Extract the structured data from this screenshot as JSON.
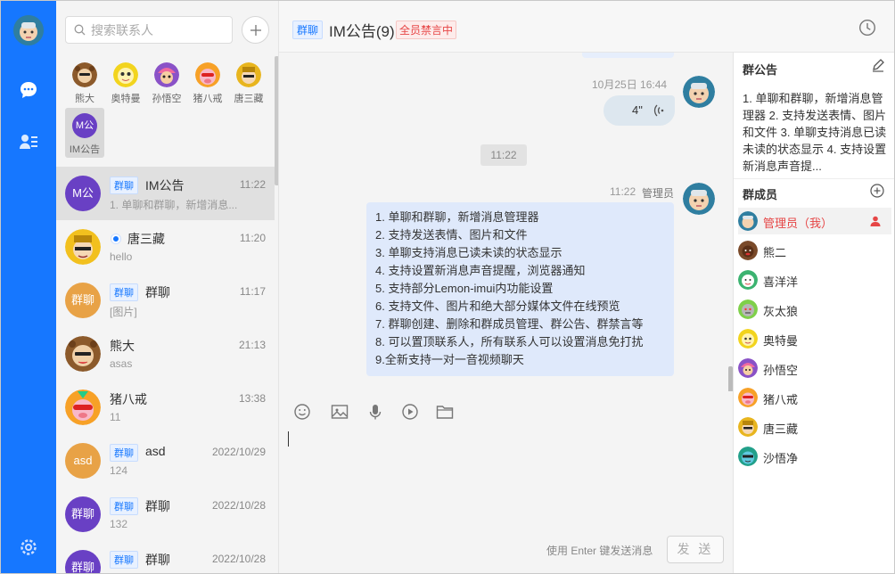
{
  "sidebar": {
    "icons": [
      "chat-icon",
      "contacts-icon",
      "settings-icon"
    ]
  },
  "search": {
    "placeholder": "搜索联系人"
  },
  "quick_contacts": [
    {
      "name": "熊大"
    },
    {
      "name": "奥特曼"
    },
    {
      "name": "孙悟空"
    },
    {
      "name": "猪八戒"
    },
    {
      "name": "唐三藏"
    },
    {
      "name": "IM公告",
      "avatar_text": "M公"
    }
  ],
  "conversations": [
    {
      "tag": "群聊",
      "name": "IM公告",
      "time": "11:22",
      "preview": "1. 单聊和群聊，新增消息...",
      "avatar_text": "M公",
      "avatar_color": "#6940c4"
    },
    {
      "tag": "",
      "name": "唐三藏",
      "time": "11:20",
      "preview": "hello",
      "avatar_text": "",
      "avatar_color": "#f2c01e"
    },
    {
      "tag": "群聊",
      "name": "群聊",
      "time": "11:17",
      "preview": "[图片]",
      "avatar_text": "群聊",
      "avatar_color": "#e8a246"
    },
    {
      "tag": "",
      "name": "熊大",
      "time": "21:13",
      "preview": "asas",
      "avatar_text": "",
      "avatar_color": "#8c5a2b"
    },
    {
      "tag": "",
      "name": "猪八戒",
      "time": "13:38",
      "preview": "11",
      "avatar_text": "",
      "avatar_color": "#f7a127"
    },
    {
      "tag": "群聊",
      "name": "asd",
      "time": "2022/10/29",
      "preview": "124",
      "avatar_text": "asd",
      "avatar_color": "#e8a246"
    },
    {
      "tag": "群聊",
      "name": "群聊",
      "time": "2022/10/28",
      "preview": "132",
      "avatar_text": "群聊",
      "avatar_color": "#6940c4"
    },
    {
      "tag": "群聊",
      "name": "群聊",
      "time": "2022/10/28",
      "preview": "",
      "avatar_text": "群聊",
      "avatar_color": "#6940c4"
    }
  ],
  "chat": {
    "tag": "群聊",
    "title": "IM公告(9)",
    "muted_badge": "全员禁言中",
    "voice_time": "10月25日 16:44",
    "voice_duration": "4\"",
    "system_time": "11:22",
    "msg_time": "11:22",
    "msg_sender": "管理员",
    "msg_lines": [
      "1. 单聊和群聊，新增消息管理器",
      "2. 支持发送表情、图片和文件",
      "3. 单聊支持消息已读未读的状态显示",
      "4. 支持设置新消息声音提醒，浏览器通知",
      "5. 支持部分Lemon-imui内功能设置",
      "6. 支持文件、图片和绝大部分媒体文件在线预览",
      "7. 群聊创建、删除和群成员管理、群公告、群禁言等",
      "8. 可以置顶联系人，所有联系人可以设置消息免打扰",
      "9.全新支持一对一音视频聊天"
    ],
    "send_hint": "使用 Enter 键发送消息",
    "send_label": "发 送"
  },
  "group_panel": {
    "notice_title": "群公告",
    "notice_text": "1. 单聊和群聊，新增消息管理器 2. 支持发送表情、图片和文件 3. 单聊支持消息已读未读的状态显示 4. 支持设置新消息声音提...",
    "members_title": "群成员",
    "members": [
      {
        "name": "管理员（我）",
        "color": "#2f7ea0"
      },
      {
        "name": "熊二",
        "color": "#7a4a2a"
      },
      {
        "name": "喜洋洋",
        "color": "#3cb371"
      },
      {
        "name": "灰太狼",
        "color": "#7fd04a"
      },
      {
        "name": "奥特曼",
        "color": "#f2d41e"
      },
      {
        "name": "孙悟空",
        "color": "#8a52c7"
      },
      {
        "name": "猪八戒",
        "color": "#f7a127"
      },
      {
        "name": "唐三藏",
        "color": "#e8b51e"
      },
      {
        "name": "沙悟净",
        "color": "#22a08a"
      }
    ]
  }
}
